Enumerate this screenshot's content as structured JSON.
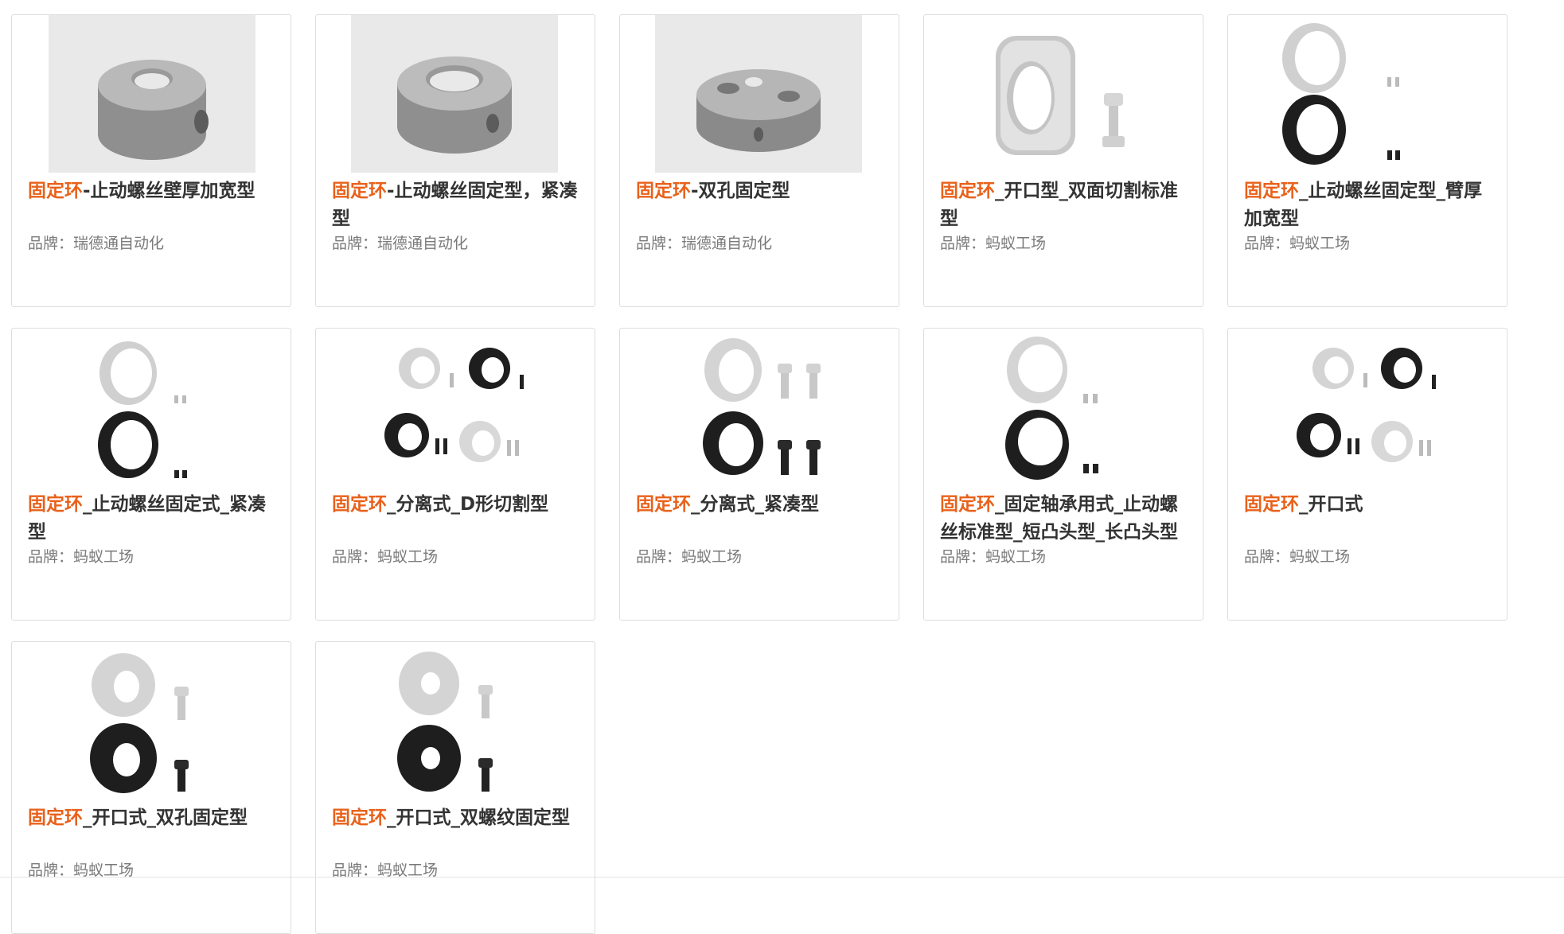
{
  "brand_prefix": "品牌：",
  "products": [
    {
      "title_kw": "固定环",
      "title_rest": "-止动螺丝壁厚加宽型",
      "brand": "瑞德通自动化",
      "image": "gray-ring-side-hole-icon"
    },
    {
      "title_kw": "固定环",
      "title_rest": "-止动螺丝固定型，紧凑型",
      "brand": "瑞德通自动化",
      "image": "gray-ring-compact-icon"
    },
    {
      "title_kw": "固定环",
      "title_rest": "-双孔固定型",
      "brand": "瑞德通自动化",
      "image": "gray-ring-double-hole-icon"
    },
    {
      "title_kw": "固定环",
      "title_rest": "_开口型_双面切割标准型",
      "brand": "蚂蚁工场",
      "image": "d-cut-collar-with-bolt-icon"
    },
    {
      "title_kw": "固定环",
      "title_rest": "_止动螺丝固定型_臂厚加宽型",
      "brand": "蚂蚁工场",
      "image": "silver-black-collar-set-screws-icon"
    },
    {
      "title_kw": "固定环",
      "title_rest": "_止动螺丝固定式_紧凑型",
      "brand": "蚂蚁工场",
      "image": "silver-black-collar-compact-icon"
    },
    {
      "title_kw": "固定环",
      "title_rest": "_分离式_D形切割型",
      "brand": "蚂蚁工场",
      "image": "split-collar-four-variant-icon"
    },
    {
      "title_kw": "固定环",
      "title_rest": "_分离式_紧凑型",
      "brand": "蚂蚁工场",
      "image": "split-collar-bolts-icon"
    },
    {
      "title_kw": "固定环",
      "title_rest": "_固定轴承用式_止动螺丝标准型_短凸头型_长凸头型",
      "brand": "蚂蚁工场",
      "image": "bearing-collar-icon"
    },
    {
      "title_kw": "固定环",
      "title_rest": "_开口式",
      "brand": "蚂蚁工场",
      "image": "open-collar-four-variant-icon"
    },
    {
      "title_kw": "固定环",
      "title_rest": "_开口式_双孔固定型",
      "brand": "蚂蚁工场",
      "image": "open-collar-double-hole-icon"
    },
    {
      "title_kw": "固定环",
      "title_rest": "_开口式_双螺纹固定型",
      "brand": "蚂蚁工场",
      "image": "open-collar-double-thread-icon"
    }
  ]
}
